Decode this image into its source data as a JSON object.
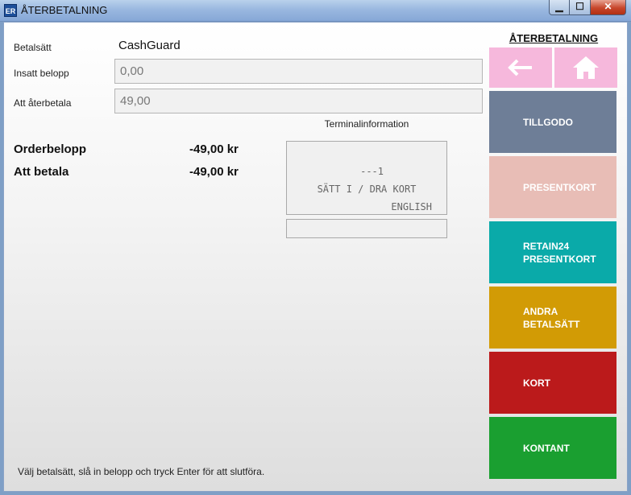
{
  "window": {
    "icon_text": "ER",
    "title": "ÅTERBETALNING",
    "min": "▁",
    "max": "☐",
    "close": "✕"
  },
  "form": {
    "method_label": "Betalsätt",
    "method_value": "CashGuard",
    "inserted_label": "Insatt belopp",
    "inserted_value": "0,00",
    "refund_label": "Att återbetala",
    "refund_value": "49,00"
  },
  "summary": {
    "order_label": "Orderbelopp",
    "order_value": "-49,00 kr",
    "pay_label": "Att betala",
    "pay_value": "-49,00 kr"
  },
  "terminal": {
    "title": "Terminalinformation",
    "lines": [
      "---1",
      "SÄTT I / DRA KORT",
      "ENGLISH"
    ],
    "input_value": ""
  },
  "hint": "Välj betalsätt, slå in belopp och tryck Enter för att slutföra.",
  "panel": {
    "title": "ÅTERBETALNING",
    "buttons": [
      {
        "label": "TILLGODO",
        "color": "#6e7e97"
      },
      {
        "label": "PRESENTKORT",
        "color": "#e8bdb6"
      },
      {
        "label": "RETAIN24\nPRESENTKORT",
        "color": "#0aaaa9"
      },
      {
        "label": "ANDRA BETALSÄTT",
        "color": "#d29b05"
      },
      {
        "label": "KORT",
        "color": "#bb1a1b"
      },
      {
        "label": "KONTANT",
        "color": "#1a9f30"
      }
    ],
    "nav_color": "#f6b8dc"
  }
}
